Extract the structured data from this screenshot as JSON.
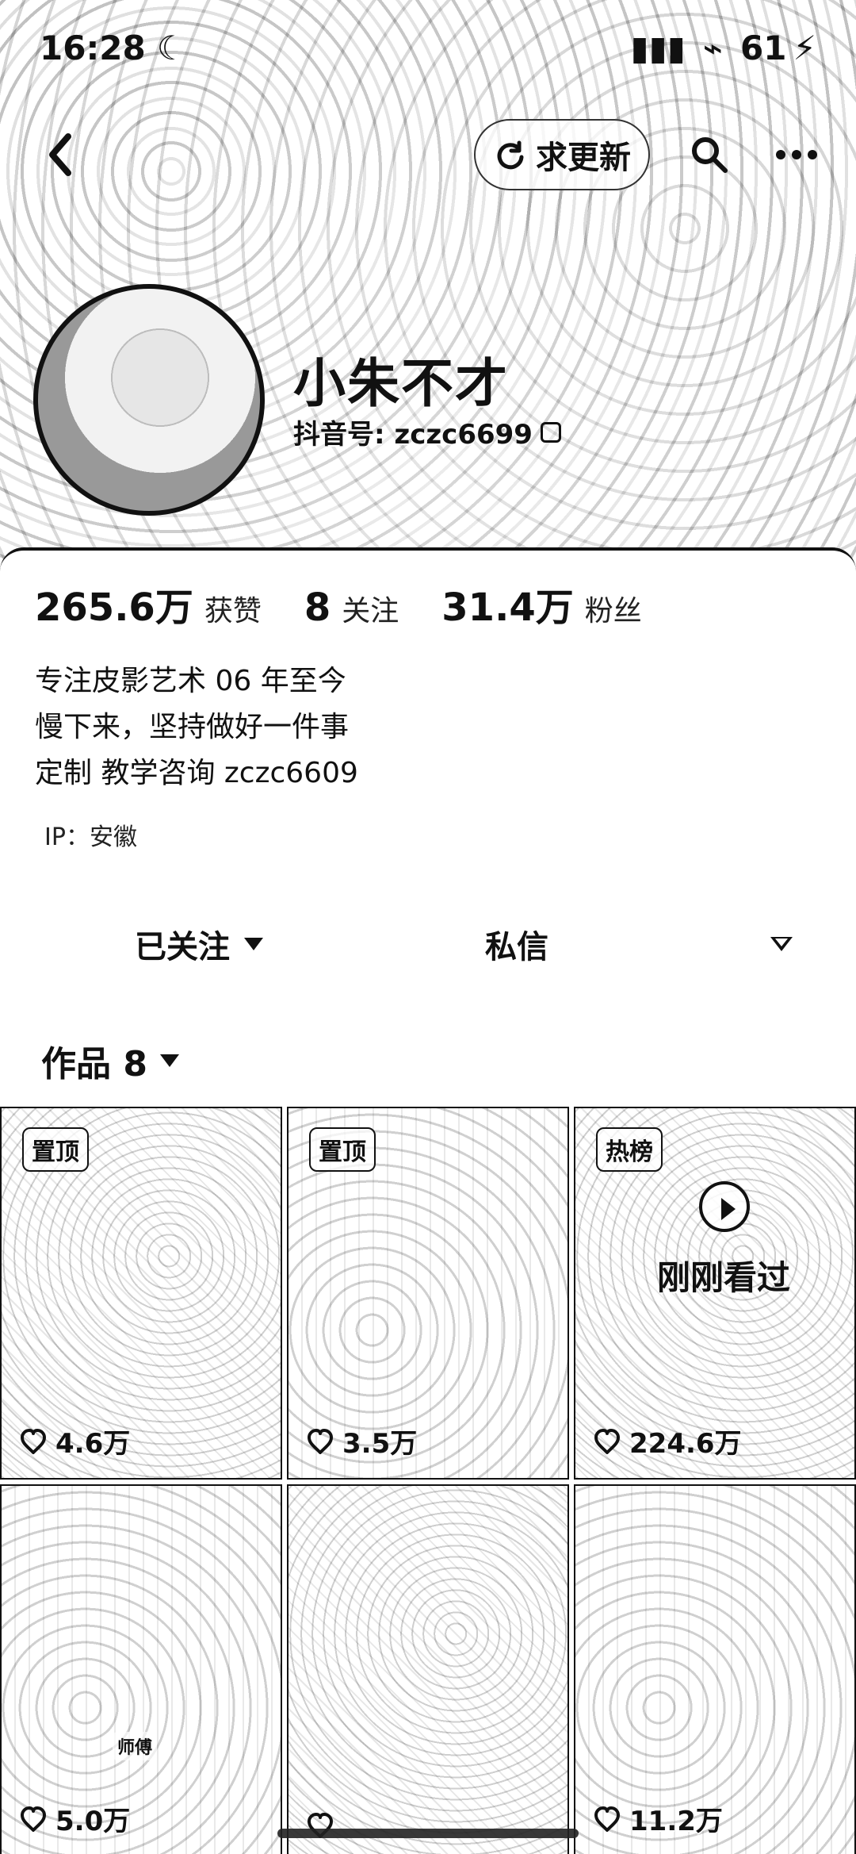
{
  "status_bar": {
    "time": "16:28",
    "battery": "61"
  },
  "header": {
    "update_request_label": "求更新"
  },
  "profile": {
    "name": "小朱不才",
    "douyin_id": "抖音号: zczc6699"
  },
  "stats": {
    "likes_value": "265.6万",
    "likes_label": "获赞",
    "following_value": "8",
    "following_label": "关注",
    "followers_value": "31.4万",
    "followers_label": "粉丝"
  },
  "bio": {
    "line1": "专注皮影艺术 06 年至今",
    "line2": "慢下来，坚持做好一件事",
    "line3": "定制 教学咨询  zczc6609",
    "ip": "IP：安徽"
  },
  "actions": {
    "following_button": "已关注",
    "message_button": "私信"
  },
  "works": {
    "header_label": "作品 8",
    "tiles": [
      {
        "badge": "置顶",
        "likes": "4.6万"
      },
      {
        "badge": "置顶",
        "likes": "3.5万"
      },
      {
        "badge": "热榜",
        "likes": "224.6万",
        "overlay": "刚刚看过"
      },
      {
        "badge": "",
        "likes": "5.0万",
        "label": "师傅"
      },
      {
        "badge": "",
        "likes": ""
      },
      {
        "badge": "",
        "likes": "11.2万"
      }
    ]
  },
  "icons": {
    "back": "back-icon",
    "refresh": "refresh-icon",
    "search": "search-icon",
    "more": "more-icon",
    "moon": "moon-icon",
    "signal": "signal-icon",
    "wifi": "wifi-icon",
    "battery": "battery-icon",
    "copy": "copy-icon",
    "heart": "heart-icon",
    "dropdown": "chevron-down-icon",
    "play": "play-icon"
  }
}
